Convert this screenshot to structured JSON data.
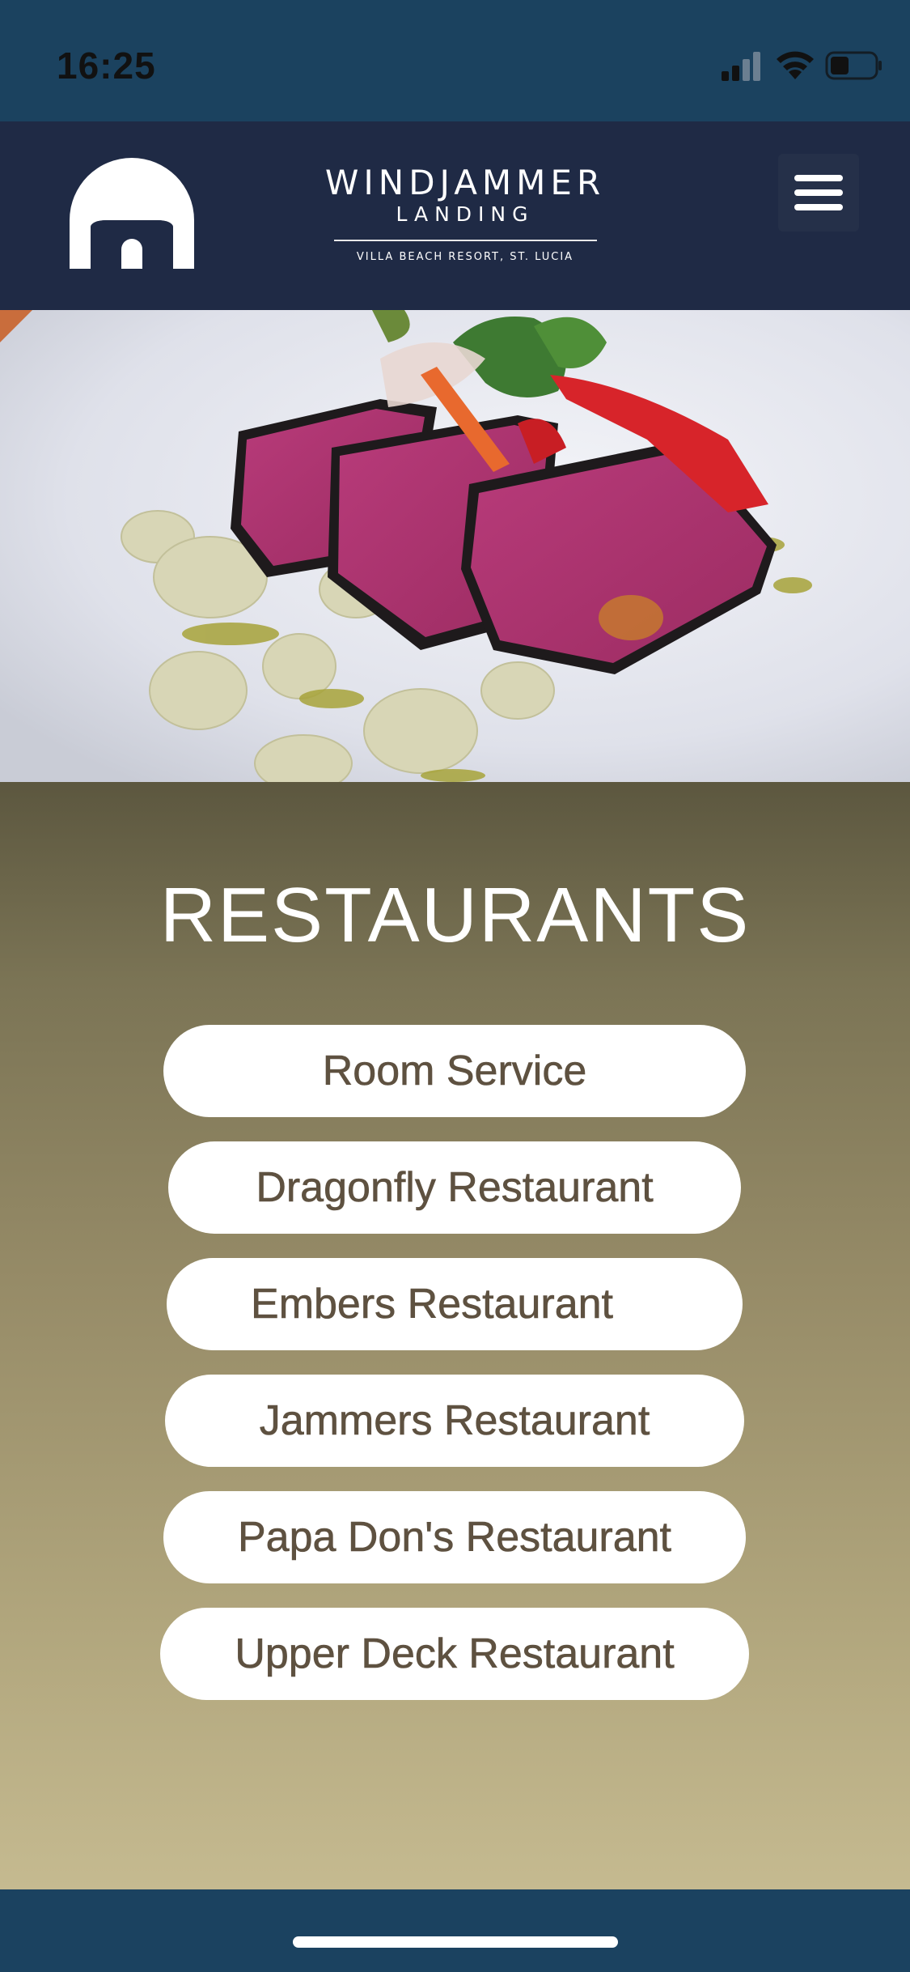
{
  "status_bar": {
    "time": "16:25",
    "icons": [
      "signal-icon",
      "wifi-icon",
      "battery-icon"
    ]
  },
  "header": {
    "logo_icon": "archway-logo-icon",
    "brand_title": "WINDJAMMER",
    "brand_subtitle": "LANDING",
    "brand_tagline": "VILLA BEACH RESORT, ST. LUCIA",
    "menu_icon": "hamburger-menu-icon"
  },
  "hero": {
    "image_subject": "seared-tuna-dish-photo"
  },
  "restaurants": {
    "title": "RESTAURANTS",
    "items": [
      {
        "label": "Room Service"
      },
      {
        "label": "Dragonfly Restaurant"
      },
      {
        "label": "Embers Restaurant"
      },
      {
        "label": "Jammers Restaurant"
      },
      {
        "label": "Papa Don's Restaurant"
      },
      {
        "label": "Upper Deck Restaurant"
      }
    ]
  },
  "colors": {
    "header_bg": "#1f2a45",
    "status_bg": "#1b425f",
    "pill_text": "#5e5140",
    "section_top": "#5c573f",
    "section_bottom": "#c5ba90"
  }
}
